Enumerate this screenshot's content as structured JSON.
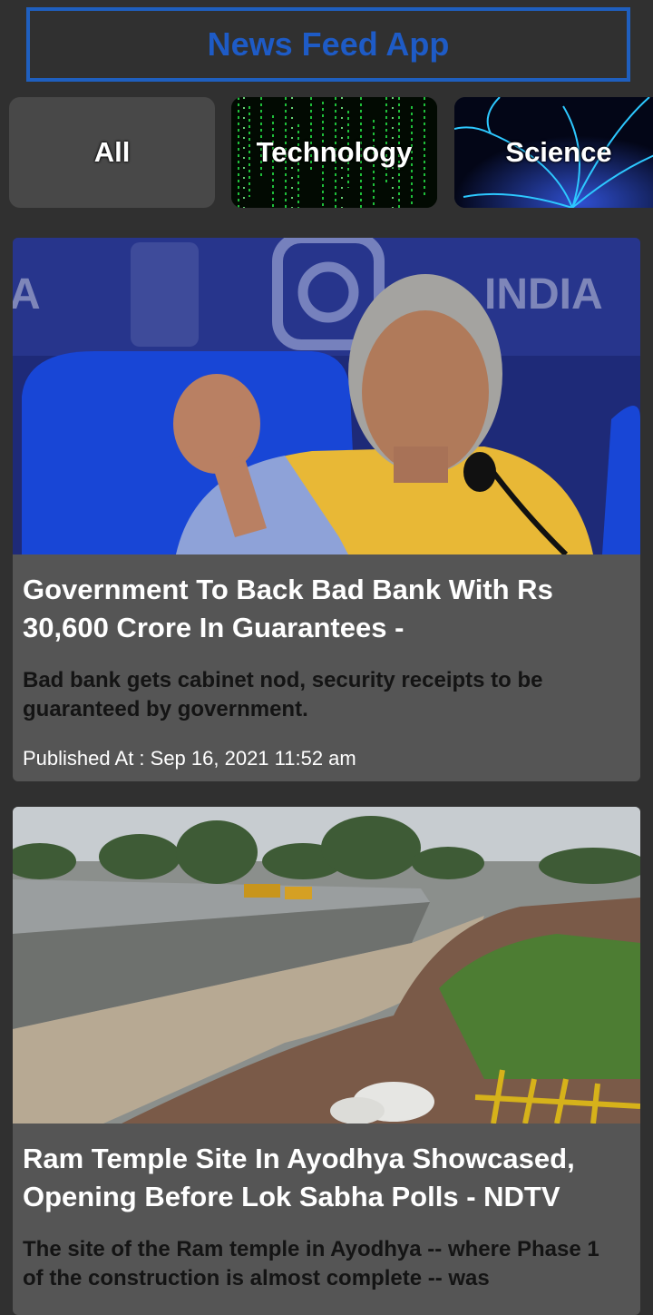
{
  "app": {
    "title": "News Feed App"
  },
  "categories": [
    {
      "label": "All"
    },
    {
      "label": "Technology"
    },
    {
      "label": "Science"
    }
  ],
  "articles": [
    {
      "title": "Government To Back Bad Bank With Rs 30,600 Crore In Guarantees -",
      "description": "Bad bank gets cabinet nod, security receipts to be guaranteed by government.",
      "published": "Published At : Sep 16, 2021 11:52 am",
      "image_text": "INDIA"
    },
    {
      "title": "Ram Temple Site In Ayodhya Showcased, Opening Before Lok Sabha Polls - NDTV",
      "description": "The site of the Ram temple in Ayodhya -- where Phase 1 of the construction is almost complete -- was"
    }
  ],
  "colors": {
    "background": "#303030",
    "accent": "#1e5bc6",
    "card": "#555555"
  }
}
